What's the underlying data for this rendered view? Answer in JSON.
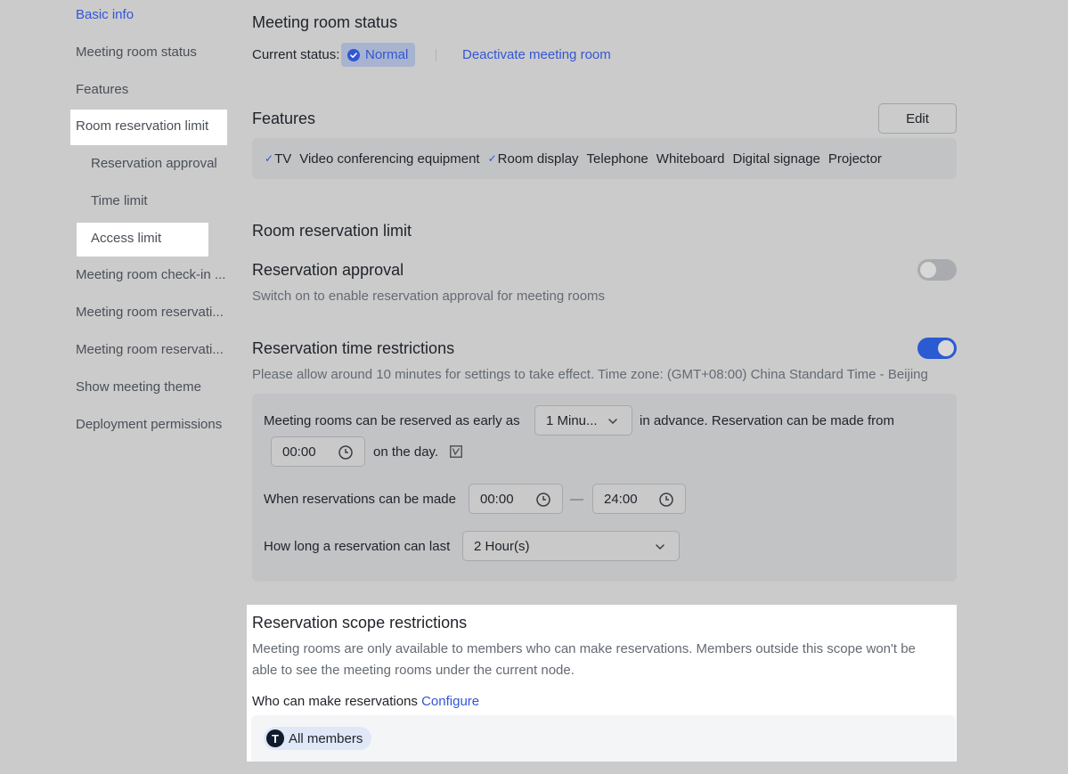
{
  "sidebar": {
    "items": [
      {
        "label": "Basic info",
        "active": true
      },
      {
        "label": "Meeting room status"
      },
      {
        "label": "Features"
      },
      {
        "label": "Room reservation limit",
        "highlighted": true
      },
      {
        "label": "Reservation approval",
        "sub": true
      },
      {
        "label": "Time limit",
        "sub": true
      },
      {
        "label": "Access limit",
        "sub": true,
        "highlighted": true
      },
      {
        "label": "Meeting room check-in ..."
      },
      {
        "label": "Meeting room reservati..."
      },
      {
        "label": "Meeting room reservati..."
      },
      {
        "label": "Show meeting theme"
      },
      {
        "label": "Deployment permissions"
      }
    ]
  },
  "status_section": {
    "title": "Meeting room status",
    "current_status_label": "Current status:",
    "status_value": "Normal",
    "deactivate_link": "Deactivate meeting room"
  },
  "features_section": {
    "title": "Features",
    "edit_label": "Edit",
    "features": [
      {
        "label": "TV",
        "checked": true
      },
      {
        "label": "Video conferencing equipment",
        "checked": false
      },
      {
        "label": "Room display",
        "checked": true
      },
      {
        "label": "Telephone",
        "checked": false
      },
      {
        "label": "Whiteboard",
        "checked": false
      },
      {
        "label": "Digital signage",
        "checked": false
      },
      {
        "label": "Projector",
        "checked": false
      }
    ]
  },
  "limit_section": {
    "title": "Room reservation limit",
    "approval": {
      "title": "Reservation approval",
      "description": "Switch on to enable reservation approval for meeting rooms",
      "enabled": false
    },
    "time": {
      "title": "Reservation time restrictions",
      "description": "Please allow around 10 minutes for settings to take effect. Time zone: (GMT+08:00) China Standard Time - Beijing",
      "enabled": true,
      "row1_prefix": "Meeting rooms can be reserved as early as",
      "advance_value": "1 Minu...",
      "row1_suffix": "in advance. Reservation can be made from",
      "from_time": "00:00",
      "row2_suffix": "on the day.",
      "window_label": "When reservations can be made",
      "window_start": "00:00",
      "window_dash": "—",
      "window_end": "24:00",
      "duration_label": "How long a reservation can last",
      "duration_value": "2 Hour(s)"
    }
  },
  "scope_section": {
    "title": "Reservation scope restrictions",
    "description_line1": "Meeting rooms are only available to members who can make reservations. Members outside this scope won't be",
    "description_line2": "able to see the meeting rooms under the current node.",
    "who_label": "Who can make reservations",
    "configure_link": "Configure",
    "member_chip": {
      "avatar_letter": "T",
      "label": "All members"
    }
  },
  "colors": {
    "accent": "#3356d4",
    "toggle_on": "#2b5bd3",
    "toggle_off": "#a9abae",
    "backdrop": "#cbcbcb"
  }
}
